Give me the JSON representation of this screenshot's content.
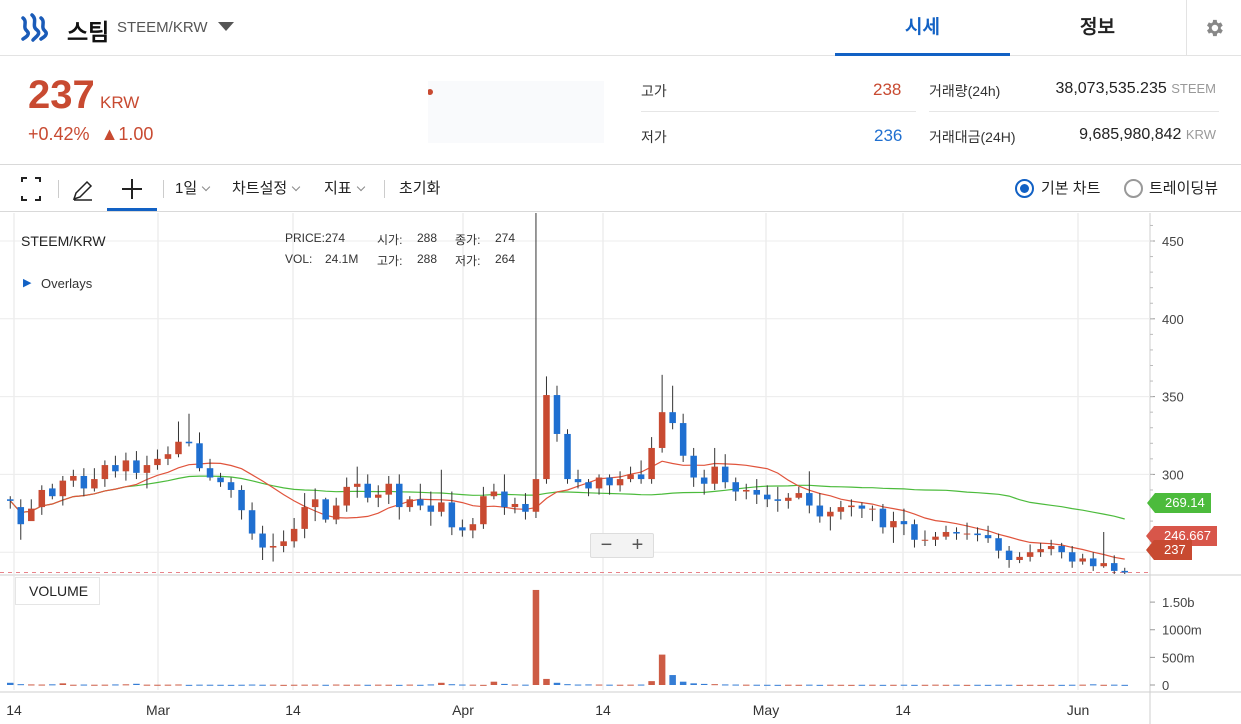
{
  "header": {
    "coin_name": "스팀",
    "pair": "STEEM/KRW",
    "tabs": [
      {
        "label": "시세",
        "active": true
      },
      {
        "label": "정보",
        "active": false
      }
    ]
  },
  "summary": {
    "price": "237",
    "price_unit": "KRW",
    "change_pct": "+0.42%",
    "change_abs": "▲1.00",
    "high_label": "고가",
    "high_value": "238",
    "low_label": "저가",
    "low_value": "236",
    "volume_label": "거래량(24h)",
    "volume_value": "38,073,535.235",
    "volume_unit": "STEEM",
    "amount_label": "거래대금(24H)",
    "amount_value": "9,685,980,842",
    "amount_unit": "KRW"
  },
  "toolbar": {
    "interval": "1일",
    "chart_settings": "차트설정",
    "indicators": "지표",
    "reset": "초기화",
    "basic_chart": "기본 차트",
    "tradingview": "트레이딩뷰"
  },
  "chart_legend": {
    "symbol": "STEEM/KRW",
    "overlays": "Overlays",
    "price_label": "PRICE:",
    "price_val": "274",
    "vol_label": "VOL:",
    "vol_val": "24.1M",
    "open_label": "시가:",
    "open_val": "288",
    "high_label": "고가:",
    "high_val": "288",
    "close_label": "종가:",
    "close_val": "274",
    "low_label": "저가:",
    "low_val": "264",
    "volume_pane": "VOLUME"
  },
  "tags": {
    "ma_long": "269.14",
    "ma_short": "246.667",
    "last": "237"
  },
  "colors": {
    "up": "#c84a31",
    "down": "#1f6fd0",
    "ma_short": "#e0543c",
    "ma_long": "#4cbb3c",
    "accent": "#1261c4"
  },
  "chart_data": {
    "type": "candlestick",
    "title": "STEEM/KRW",
    "x_ticks": [
      "14",
      "Mar",
      "14",
      "Apr",
      "14",
      "May",
      "14",
      "Jun"
    ],
    "y_ticks": [
      300,
      350,
      400,
      450
    ],
    "ylim": [
      236,
      468
    ],
    "vol_ticks": [
      "0",
      "500m",
      "1000m",
      "1.50b"
    ],
    "last_price": 237,
    "ma_long_last": 269.14,
    "ma_short_last": 246.667,
    "candles": [
      [
        284,
        283,
        286,
        278
      ],
      [
        279,
        268,
        284,
        258
      ],
      [
        270,
        278,
        284,
        276
      ],
      [
        279,
        290,
        293,
        274
      ],
      [
        291,
        286,
        294,
        284
      ],
      [
        286,
        296,
        299,
        280
      ],
      [
        296,
        299,
        303,
        292
      ],
      [
        299,
        291,
        304,
        286
      ],
      [
        291,
        297,
        304,
        289
      ],
      [
        297,
        306,
        309,
        292
      ],
      [
        306,
        302,
        312,
        298
      ],
      [
        302,
        309,
        314,
        296
      ],
      [
        309,
        301,
        315,
        297
      ],
      [
        301,
        306,
        312,
        291
      ],
      [
        306,
        310,
        316,
        303
      ],
      [
        310,
        313,
        318,
        306
      ],
      [
        313,
        321,
        334,
        311
      ],
      [
        321,
        320,
        339,
        318
      ],
      [
        320,
        304,
        327,
        302
      ],
      [
        304,
        298,
        310,
        296
      ],
      [
        298,
        295,
        301,
        292
      ],
      [
        295,
        290,
        298,
        285
      ],
      [
        290,
        277,
        293,
        271
      ],
      [
        277,
        262,
        282,
        258
      ],
      [
        262,
        253,
        267,
        245
      ],
      [
        253,
        254,
        262,
        244
      ],
      [
        254,
        257,
        264,
        250
      ],
      [
        257,
        265,
        272,
        253
      ],
      [
        265,
        279,
        288,
        259
      ],
      [
        279,
        284,
        291,
        270
      ],
      [
        284,
        271,
        285,
        269
      ],
      [
        271,
        280,
        285,
        268
      ],
      [
        280,
        292,
        298,
        276
      ],
      [
        292,
        294,
        305,
        285
      ],
      [
        294,
        285,
        300,
        282
      ],
      [
        285,
        287,
        293,
        279
      ],
      [
        287,
        294,
        299,
        281
      ],
      [
        294,
        279,
        300,
        271
      ],
      [
        279,
        284,
        286,
        276
      ],
      [
        284,
        280,
        294,
        277
      ],
      [
        280,
        276,
        289,
        267
      ],
      [
        276,
        282,
        303,
        273
      ],
      [
        282,
        266,
        289,
        261
      ],
      [
        266,
        264,
        271,
        260
      ],
      [
        264,
        268,
        272,
        259
      ],
      [
        268,
        286,
        292,
        265
      ],
      [
        286,
        289,
        294,
        284
      ],
      [
        289,
        279,
        300,
        274
      ],
      [
        279,
        281,
        285,
        275
      ],
      [
        281,
        276,
        288,
        271
      ],
      [
        276,
        297,
        468,
        272
      ],
      [
        297,
        351,
        363,
        294
      ],
      [
        351,
        326,
        357,
        321
      ],
      [
        326,
        297,
        329,
        294
      ],
      [
        297,
        295,
        303,
        291
      ],
      [
        295,
        291,
        297,
        286
      ],
      [
        291,
        298,
        300,
        287
      ],
      [
        298,
        293,
        300,
        287
      ],
      [
        293,
        297,
        302,
        289
      ],
      [
        297,
        300,
        305,
        295
      ],
      [
        300,
        297,
        309,
        294
      ],
      [
        297,
        317,
        324,
        294
      ],
      [
        317,
        340,
        364,
        314
      ],
      [
        340,
        333,
        357,
        329
      ],
      [
        333,
        312,
        339,
        308
      ],
      [
        312,
        298,
        317,
        292
      ],
      [
        298,
        294,
        303,
        287
      ],
      [
        294,
        305,
        317,
        290
      ],
      [
        305,
        295,
        313,
        291
      ],
      [
        295,
        289,
        298,
        283
      ],
      [
        289,
        290,
        294,
        284
      ],
      [
        290,
        287,
        297,
        281
      ],
      [
        287,
        284,
        293,
        279
      ],
      [
        284,
        283,
        292,
        276
      ],
      [
        283,
        285,
        288,
        278
      ],
      [
        285,
        288,
        292,
        284
      ],
      [
        288,
        280,
        302,
        275
      ],
      [
        280,
        273,
        288,
        269
      ],
      [
        273,
        276,
        279,
        264
      ],
      [
        276,
        279,
        283,
        271
      ],
      [
        279,
        280,
        284,
        273
      ],
      [
        280,
        278,
        282,
        272
      ],
      [
        278,
        278,
        280,
        270
      ],
      [
        278,
        266,
        281,
        262
      ],
      [
        266,
        270,
        276,
        256
      ],
      [
        270,
        268,
        278,
        261
      ],
      [
        268,
        258,
        271,
        253
      ],
      [
        258,
        258,
        264,
        254
      ],
      [
        258,
        260,
        263,
        254
      ],
      [
        260,
        263,
        267,
        258
      ],
      [
        263,
        262,
        266,
        258
      ],
      [
        262,
        262,
        269,
        258
      ],
      [
        262,
        261,
        266,
        257
      ],
      [
        261,
        259,
        267,
        256
      ],
      [
        259,
        251,
        262,
        246
      ],
      [
        251,
        245,
        254,
        240
      ],
      [
        245,
        247,
        250,
        243
      ],
      [
        247,
        250,
        255,
        244
      ],
      [
        250,
        252,
        256,
        247
      ],
      [
        252,
        254,
        258,
        248
      ],
      [
        254,
        250,
        256,
        246
      ],
      [
        250,
        244,
        254,
        240
      ],
      [
        244,
        246,
        249,
        242
      ],
      [
        246,
        241,
        250,
        238
      ],
      [
        241,
        243,
        263,
        240
      ],
      [
        243,
        238,
        248,
        236
      ],
      [
        238,
        237,
        240,
        236
      ]
    ],
    "volumes": [
      40,
      15,
      10,
      8,
      12,
      30,
      5,
      8,
      5,
      6,
      10,
      12,
      22,
      6,
      5,
      6,
      9,
      3,
      6,
      5,
      4,
      3,
      5,
      8,
      5,
      6,
      3,
      5,
      6,
      7,
      4,
      8,
      5,
      6,
      4,
      6,
      5,
      3,
      7,
      4,
      10,
      40,
      14,
      8,
      6,
      3,
      60,
      20,
      8,
      6,
      1720,
      110,
      40,
      15,
      8,
      10,
      8,
      6,
      5,
      6,
      8,
      70,
      550,
      180,
      60,
      30,
      20,
      15,
      10,
      8,
      6,
      5,
      4,
      3,
      5,
      4,
      6,
      3,
      5,
      4,
      3,
      4,
      5,
      3,
      4,
      5,
      3,
      4,
      6,
      4,
      5,
      3,
      4,
      3,
      5,
      4,
      3,
      4,
      3,
      4,
      3,
      5,
      6,
      12,
      4,
      6,
      3
    ]
  }
}
